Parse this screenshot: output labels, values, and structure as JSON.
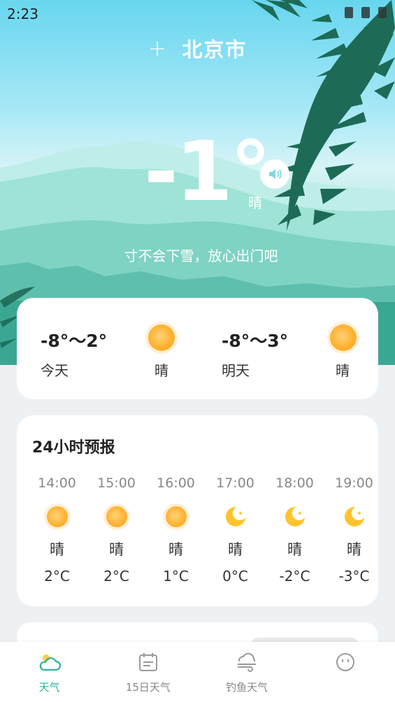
{
  "status_bar": {
    "time": "2:23"
  },
  "header": {
    "add_symbol": "+",
    "city": "北京市"
  },
  "current": {
    "temperature": "-1°",
    "condition": "晴",
    "tip": "寸不会下雪，放心出门吧"
  },
  "daily": [
    {
      "range": "-8°～2°",
      "label": "今天",
      "condition": "晴",
      "icon": "sun-icon"
    },
    {
      "range": "-8°～3°",
      "label": "明天",
      "condition": "晴",
      "icon": "sun-icon"
    }
  ],
  "hourly": {
    "title": "24小时预报",
    "items": [
      {
        "time": "14:00",
        "icon": "sun-icon",
        "condition": "晴",
        "temp": "2°C"
      },
      {
        "time": "15:00",
        "icon": "sun-icon",
        "condition": "晴",
        "temp": "2°C"
      },
      {
        "time": "16:00",
        "icon": "sun-icon",
        "condition": "晴",
        "temp": "1°C"
      },
      {
        "time": "17:00",
        "icon": "moon-icon",
        "condition": "晴",
        "temp": "0°C"
      },
      {
        "time": "18:00",
        "icon": "moon-icon",
        "condition": "晴",
        "temp": "-2°C"
      },
      {
        "time": "19:00",
        "icon": "moon-icon",
        "condition": "晴",
        "temp": "-3°C"
      }
    ]
  },
  "nav": {
    "items": [
      {
        "label": "天气",
        "icon": "cloud-icon",
        "active": true
      },
      {
        "label": "15日天气",
        "icon": "calendar-icon",
        "active": false
      },
      {
        "label": "钓鱼天气",
        "icon": "wind-icon",
        "active": false
      },
      {
        "label": "",
        "icon": "face-icon",
        "active": false
      }
    ]
  },
  "colors": {
    "accent": "#2bb39b",
    "leaf": "#1d6b57",
    "sky": "#67d6ef"
  }
}
